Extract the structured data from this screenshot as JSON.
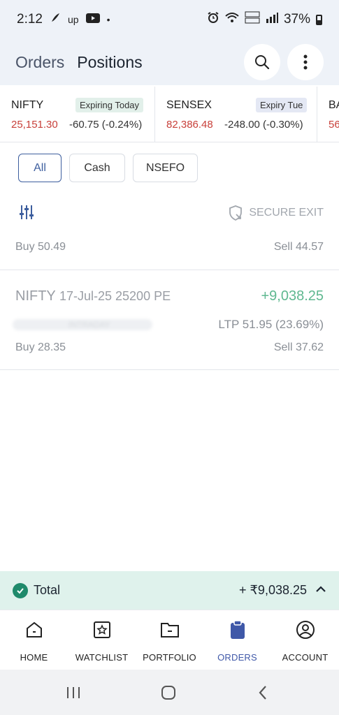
{
  "status_bar": {
    "time": "2:12",
    "battery": "37%",
    "dot": "•",
    "up_label": "up"
  },
  "header": {
    "tabs": [
      "Orders",
      "Positions"
    ],
    "active_tab": "Positions"
  },
  "ticker": [
    {
      "name": "NIFTY",
      "badge": "Expiring Today",
      "price": "25,151.30",
      "change": "-60.75 (-0.24%)"
    },
    {
      "name": "SENSEX",
      "badge": "Expiry Tue",
      "price": "82,386.48",
      "change": "-248.00 (-0.30%)"
    },
    {
      "name": "BA",
      "price": "56"
    }
  ],
  "filters": {
    "chips": [
      "All",
      "Cash",
      "NSEFO"
    ],
    "active": "All"
  },
  "secure_exit_label": "SECURE EXIT",
  "positions": [
    {
      "buy": "Buy 50.49",
      "sell": "Sell 44.57"
    },
    {
      "symbol": "NIFTY",
      "detail": "17-Jul-25 25200 PE",
      "pnl": "+9,038.25",
      "product": "INTRADAY",
      "ltp": "LTP 51.95 (23.69%)",
      "buy": "Buy 28.35",
      "sell": "Sell 37.62"
    }
  ],
  "total": {
    "label": "Total",
    "value": "+ ₹9,038.25"
  },
  "nav": {
    "items": [
      "HOME",
      "WATCHLIST",
      "PORTFOLIO",
      "ORDERS",
      "ACCOUNT"
    ],
    "active": "ORDERS"
  },
  "colors": {
    "accent": "#3f58a8",
    "loss": "#c8403a",
    "profit": "#5fb890",
    "total_bg": "#dff2ec"
  }
}
